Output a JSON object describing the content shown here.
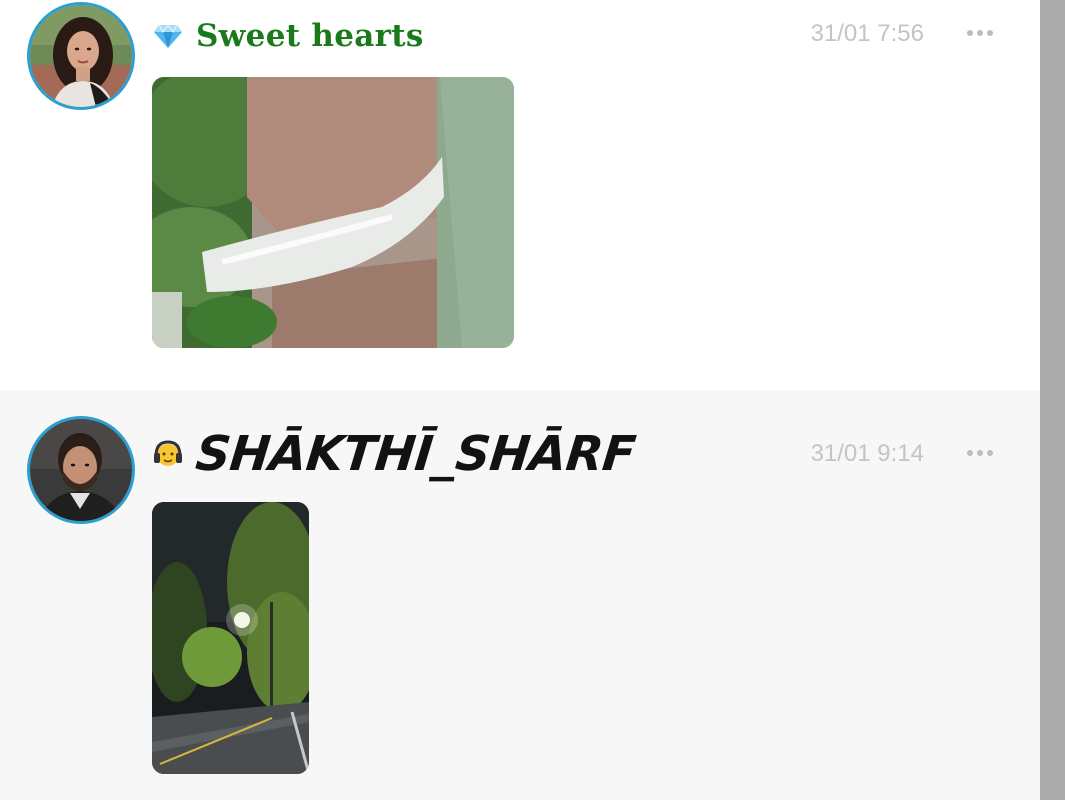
{
  "posts": [
    {
      "username": "Sweet hearts",
      "badge_icon": "diamond-icon",
      "timestamp": "31/01 7:56",
      "avatar": "profile-photo-woman",
      "photo": "waterfall-photo",
      "more_icon": "more-options-icon",
      "name_color": "#1a7a1a"
    },
    {
      "username": "SHĀKTHĪ_SHĀRF",
      "badge_icon": "headphones-emoji-icon",
      "timestamp": "31/01 9:14",
      "avatar": "profile-photo-man",
      "photo": "night-street-photo",
      "more_icon": "more-options-icon",
      "name_color": "#121212"
    }
  ],
  "colors": {
    "avatar_ring": "#2b9fd0",
    "timestamp": "#c4c4c4",
    "scrollbar": "#ababab",
    "alt_post_bg": "#f7f7f7"
  }
}
